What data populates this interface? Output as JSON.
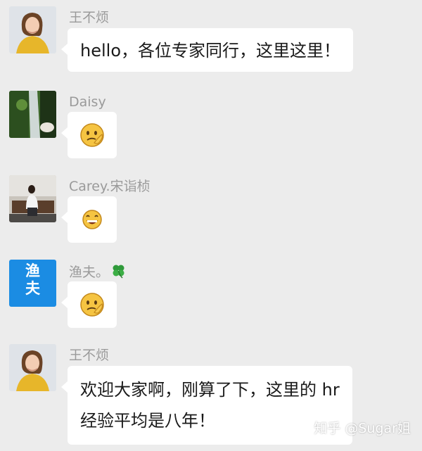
{
  "messages": [
    {
      "sender": "王不烦",
      "text": "hello，各位专家同行，这里这里！",
      "type": "text",
      "avatar": "woman-yellow-sweater-avatar"
    },
    {
      "sender": "Daisy",
      "type": "emoji",
      "emoji": "thinking-face-emoji",
      "avatar": "landscape-waterfall-avatar"
    },
    {
      "sender": "Carey.宋诣桢",
      "type": "emoji",
      "emoji": "grinning-face-emoji",
      "avatar": "person-sitting-avatar"
    },
    {
      "sender": "渔夫。",
      "sender_suffix_icon": "four-leaf-clover-icon",
      "type": "emoji",
      "emoji": "thinking-face-emoji",
      "avatar": "blue-logo-avatar",
      "avatar_text": "渔夫"
    },
    {
      "sender": "王不烦",
      "text_line1": "欢迎大家啊，刚算了下，这里的 hr",
      "text_line2": "经验平均是八年！",
      "type": "text",
      "avatar": "woman-yellow-sweater-avatar"
    }
  ],
  "watermark": "知乎 @Sugar姐",
  "colors": {
    "background": "#ececec",
    "bubble": "#ffffff",
    "sender": "#9a9a9a",
    "avatar_blue": "#1b8ce3"
  }
}
